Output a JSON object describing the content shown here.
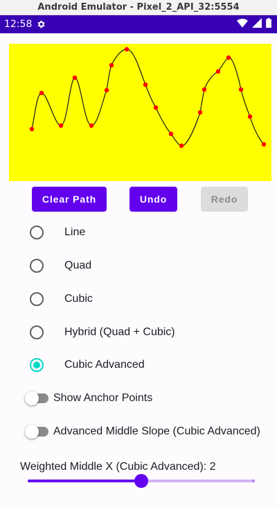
{
  "window": {
    "title": "Android Emulator - Pixel_2_API_32:5554"
  },
  "status_bar": {
    "time": "12:58",
    "icons": [
      "gear-icon",
      "wifi-icon",
      "signal-icon",
      "battery-icon"
    ]
  },
  "canvas": {
    "background": "#ffff00",
    "curve_color": "#1a1a1a",
    "point_color": "#ff0000"
  },
  "buttons": {
    "clear_path": "Clear Path",
    "undo": "Undo",
    "redo": "Redo",
    "redo_enabled": false
  },
  "radio_options": [
    {
      "label": "Line",
      "selected": false
    },
    {
      "label": "Quad",
      "selected": false
    },
    {
      "label": "Cubic",
      "selected": false
    },
    {
      "label": "Hybrid (Quad + Cubic)",
      "selected": false
    },
    {
      "label": "Cubic Advanced",
      "selected": true
    }
  ],
  "switches": [
    {
      "label": "Show Anchor Points",
      "on": false
    },
    {
      "label": "Advanced Middle Slope (Cubic Advanced)",
      "on": false
    }
  ],
  "slider": {
    "label": "Weighted Middle X (Cubic Advanced): 2",
    "fraction": 0.5
  },
  "colors": {
    "primary": "#6200ee",
    "status_bar": "#3700b3",
    "radio_selected": "#03dac5",
    "slider_inactive": "#d1b3f7",
    "disabled_button": "#dcdcdc"
  }
}
